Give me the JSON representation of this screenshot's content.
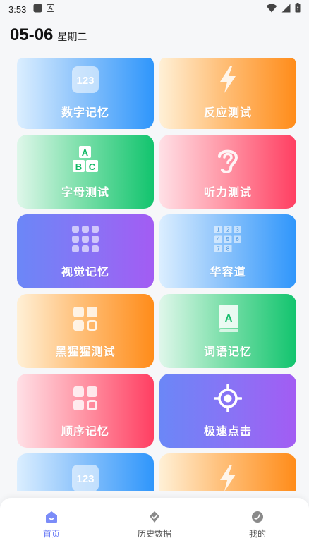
{
  "status_bar": {
    "time": "3:53"
  },
  "header": {
    "date": "05-06",
    "weekday": "星期二"
  },
  "cards": [
    {
      "label": "数字记忆",
      "icon": "number-123-icon",
      "icon_text": "123",
      "theme": "blue"
    },
    {
      "label": "反应测试",
      "icon": "lightning-icon",
      "theme": "orange"
    },
    {
      "label": "字母测试",
      "icon": "abc-letters-icon",
      "icon_letters": [
        "A",
        "B",
        "C"
      ],
      "theme": "green"
    },
    {
      "label": "听力测试",
      "icon": "ear-icon",
      "theme": "pink"
    },
    {
      "label": "视觉记忆",
      "icon": "dots-grid-icon",
      "theme": "purple"
    },
    {
      "label": "华容道",
      "icon": "number-grid-icon",
      "icon_numbers": [
        "1",
        "2",
        "3",
        "4",
        "5",
        "6",
        "7",
        "8"
      ],
      "theme": "blue"
    },
    {
      "label": "黑猩猩测试",
      "icon": "squares-icon",
      "theme": "orange"
    },
    {
      "label": "词语记忆",
      "icon": "book-icon",
      "icon_text": "A",
      "theme": "green"
    },
    {
      "label": "顺序记忆",
      "icon": "squares-icon",
      "theme": "pink"
    },
    {
      "label": "极速点击",
      "icon": "target-icon",
      "theme": "purple"
    },
    {
      "label": "",
      "icon": "number-123-icon",
      "icon_text": "123",
      "theme": "blue"
    },
    {
      "label": "",
      "icon": "lightning-icon",
      "theme": "orange"
    }
  ],
  "bottom_nav": [
    {
      "label": "首页",
      "icon": "home-icon",
      "active": true
    },
    {
      "label": "历史数据",
      "icon": "history-icon",
      "active": false
    },
    {
      "label": "我的",
      "icon": "profile-icon",
      "active": false
    }
  ],
  "colors": {
    "accent": "#6b7cf6"
  }
}
